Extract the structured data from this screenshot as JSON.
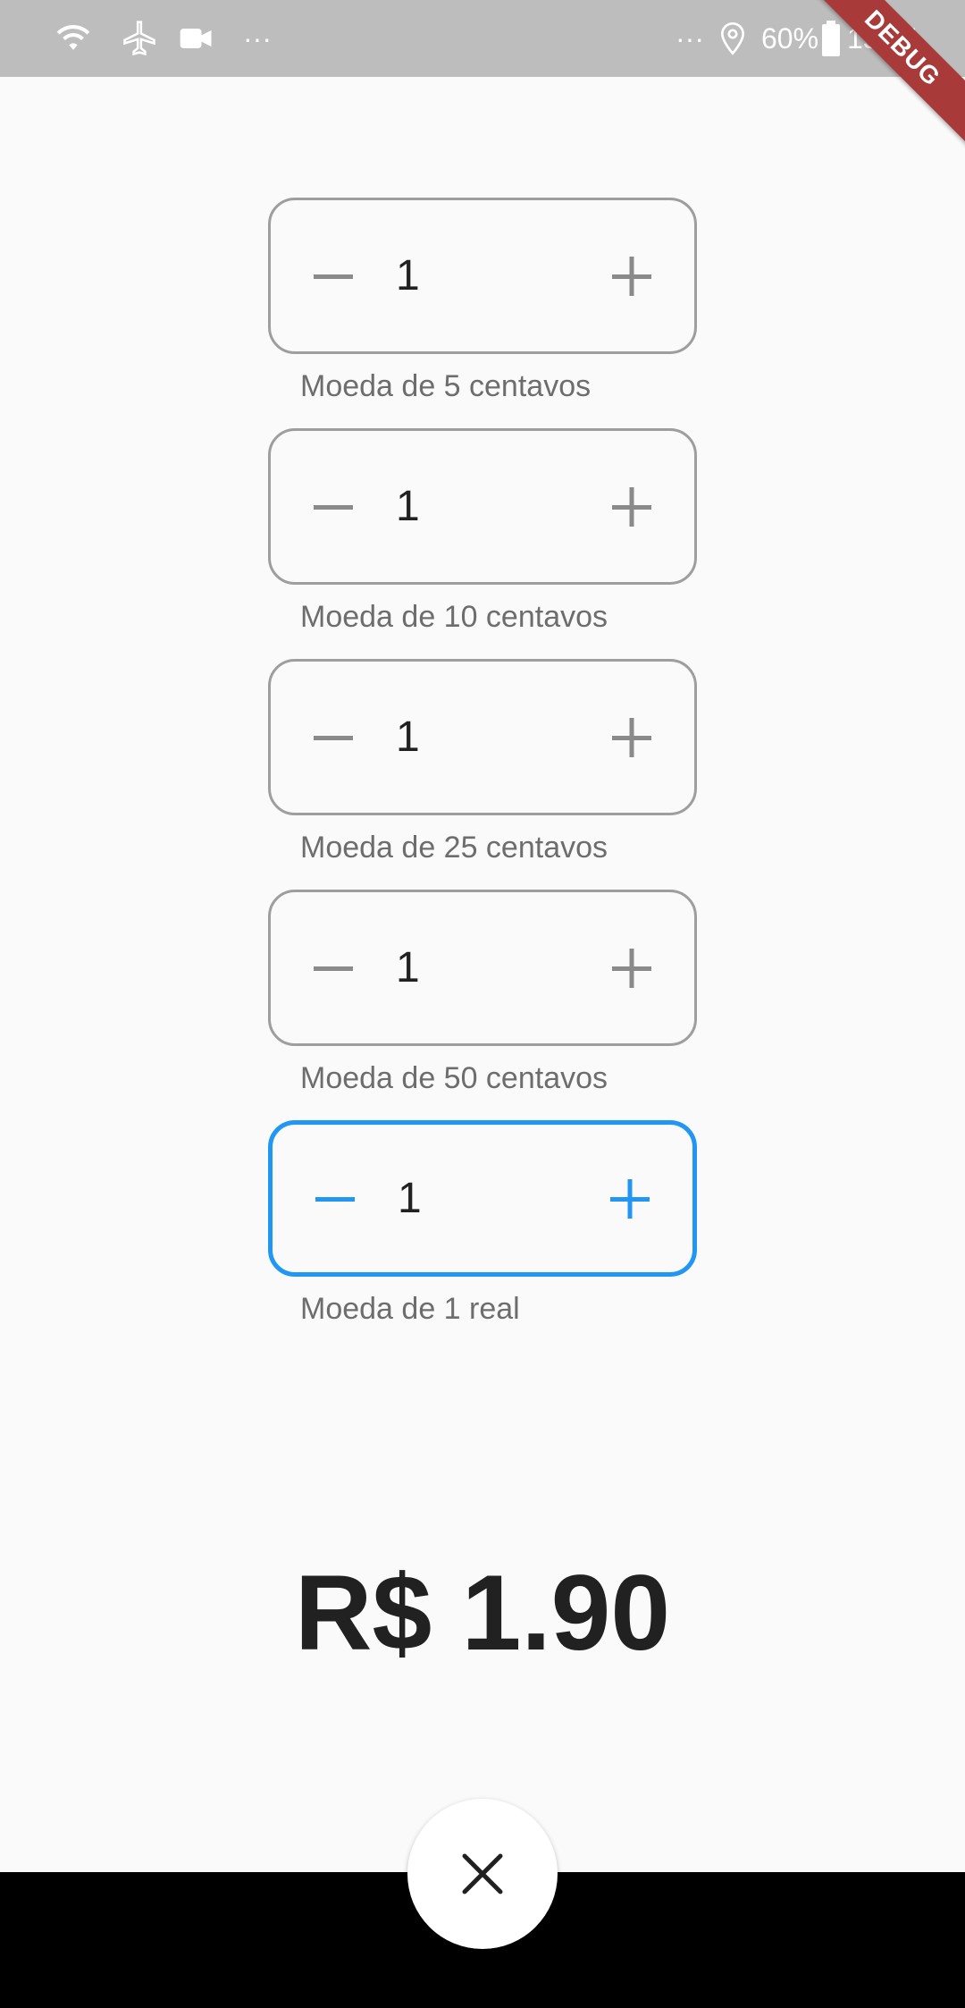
{
  "status_bar": {
    "battery": "60%",
    "time": "15:04",
    "debug_label": "DEBUG",
    "left_icons": [
      "wifi-icon",
      "airplane-icon",
      "video-icon",
      "more-icon"
    ],
    "right_icons": [
      "more-icon",
      "location-icon",
      "battery-icon"
    ]
  },
  "counters": [
    {
      "value": "1",
      "label": "Moeda de 5 centavos"
    },
    {
      "value": "1",
      "label": "Moeda de 10 centavos"
    },
    {
      "value": "1",
      "label": "Moeda de 25 centavos"
    },
    {
      "value": "1",
      "label": "Moeda de 50 centavos"
    },
    {
      "value": "1",
      "label": "Moeda de 1 real",
      "focused": true
    }
  ],
  "total": "R$ 1.90",
  "fab": {
    "icon": "close-icon"
  },
  "colors": {
    "accent": "#2196f3",
    "border": "#9e9e9e",
    "text": "#212121",
    "label": "#6d6d6d"
  }
}
